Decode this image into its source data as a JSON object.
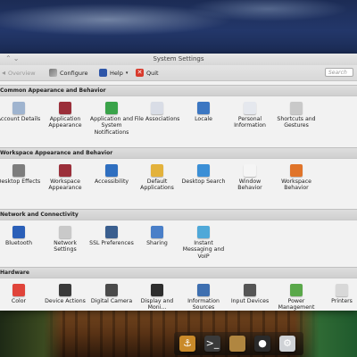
{
  "window": {
    "title": "System Settings"
  },
  "toolbar": {
    "overview_label": "Overview",
    "configure_label": "Configure",
    "help_label": "Help",
    "quit_label": "Quit",
    "search_placeholder": "Search"
  },
  "sections": [
    {
      "title": "Common Appearance and Behavior",
      "items": [
        {
          "label": "Account Details",
          "color": "#9fb4cf"
        },
        {
          "label": "Application Appearance",
          "color": "#9b2f3a"
        },
        {
          "label": "Application and System Notifications",
          "color": "#3aa34a"
        },
        {
          "label": "File Associations",
          "color": "#d9dde6"
        },
        {
          "label": "Locale",
          "color": "#3c77c2"
        },
        {
          "label": "Personal Information",
          "color": "#e5e8ee"
        },
        {
          "label": "Shortcuts and Gestures",
          "color": "#c9c9c9"
        }
      ]
    },
    {
      "title": "Workspace Appearance and Behavior",
      "items": [
        {
          "label": "Desktop Effects",
          "color": "#7d7d7d"
        },
        {
          "label": "Workspace Appearance",
          "color": "#9b2f3a"
        },
        {
          "label": "Accessibility",
          "color": "#2f6fc0"
        },
        {
          "label": "Default Applications",
          "color": "#e3b23c"
        },
        {
          "label": "Desktop Search",
          "color": "#3b8fd6"
        },
        {
          "label": "Window Behavior",
          "color": "#f5f5f5"
        },
        {
          "label": "Workspace Behavior",
          "color": "#e0742a"
        }
      ]
    },
    {
      "title": "Network and Connectivity",
      "items": [
        {
          "label": "Bluetooth",
          "color": "#2a5fb8"
        },
        {
          "label": "Network Settings",
          "color": "#c9c9c9"
        },
        {
          "label": "SSL Preferences",
          "color": "#3a5e8e"
        },
        {
          "label": "Sharing",
          "color": "#4a7fc8"
        },
        {
          "label": "Instant Messaging and VoIP",
          "color": "#4fa8d8"
        }
      ]
    },
    {
      "title": "Hardware",
      "items": [
        {
          "label": "Color",
          "color": "#e0443a"
        },
        {
          "label": "Device Actions",
          "color": "#3a3a3a"
        },
        {
          "label": "Digital Camera",
          "color": "#4a4a4a"
        },
        {
          "label": "Display and Moni...",
          "color": "#2e2e2e"
        },
        {
          "label": "Information Sources",
          "color": "#3e6fb0"
        },
        {
          "label": "Input Devices",
          "color": "#555555"
        },
        {
          "label": "Power Management",
          "color": "#5aa84a"
        },
        {
          "label": "Printers",
          "color": "#d8d8d8"
        }
      ]
    }
  ],
  "dock": {
    "icons": [
      "anchor-icon",
      "terminal-icon",
      "chat-icon",
      "circle-app-icon",
      "settings-app-icon"
    ],
    "colors": [
      "#c98a2a",
      "#3a3a3a",
      "#b08640",
      "#2a2a2a",
      "#cfd2d6"
    ]
  }
}
